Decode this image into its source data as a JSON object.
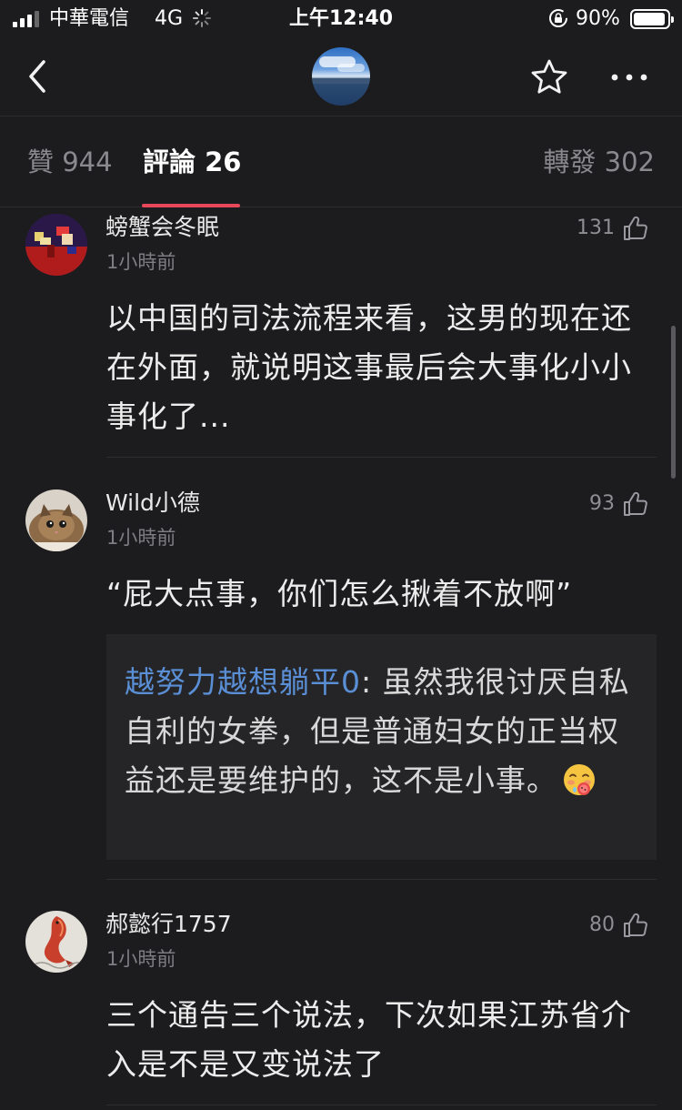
{
  "status_bar": {
    "carrier": "中華電信",
    "network": "4G",
    "time": "上午12:40",
    "battery": "90%"
  },
  "nav": {
    "back_icon": "chevron-left-icon",
    "favorite_icon": "star-icon",
    "more_icon": "more-horizontal-icon"
  },
  "tabs": {
    "likes": "贊 944",
    "comments": "評論 26",
    "reposts": "轉發 302",
    "active": "comments",
    "accent_color": "#e8485a"
  },
  "comments": [
    {
      "username": "螃蟹会冬眠",
      "time": "1小時前",
      "likes": "131",
      "text": "以中国的司法流程来看，这男的现在还在外面，就说明这事最后会大事化小小事化了..."
    },
    {
      "username": "Wild小德",
      "time": "1小時前",
      "likes": "93",
      "text": "“屁大点事，你们怎么揪着不放啊”",
      "reply": {
        "author": "越努力越想躺平0",
        "separator": ": ",
        "text": "虽然我很讨厌自私自利的女拳，但是普通妇女的正当权益还是要维护的，这不是小事。",
        "emoji": "drooling-face-emoji"
      }
    },
    {
      "username": "郝懿行1757",
      "time": "1小時前",
      "likes": "80",
      "text": "三个通告三个说法，下次如果江苏省介入是不是又变说法了"
    }
  ]
}
